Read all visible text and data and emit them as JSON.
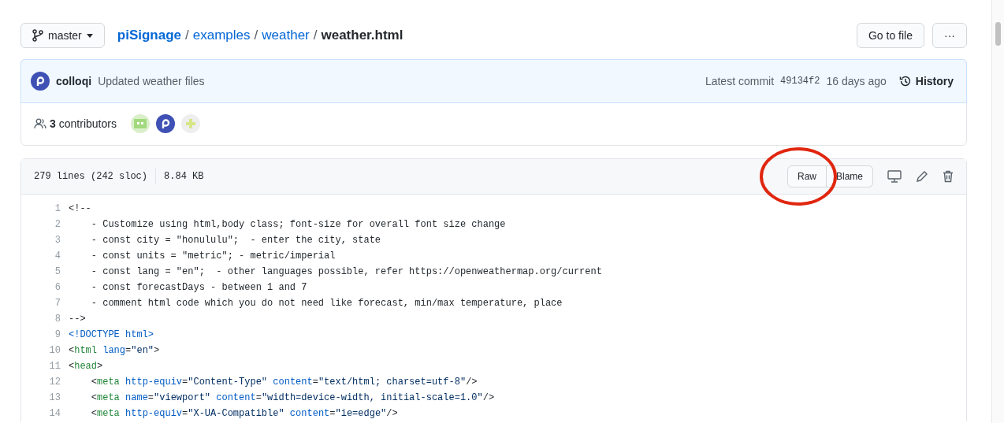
{
  "branch": {
    "label": "master"
  },
  "breadcrumb_separator": "/",
  "breadcrumb": [
    {
      "text": "piSignage",
      "kind": "repo"
    },
    {
      "text": "examples",
      "kind": "link"
    },
    {
      "text": "weather",
      "kind": "link"
    },
    {
      "text": "weather.html",
      "kind": "current"
    }
  ],
  "actions": {
    "go_to_file": "Go to file",
    "more": "···"
  },
  "commit": {
    "author": "colloqi",
    "message": "Updated weather files",
    "latest_label": "Latest commit",
    "sha": "49134f2",
    "age": "16 days ago",
    "history": "History"
  },
  "contributors": {
    "count": "3",
    "label": "contributors",
    "avatars": [
      {
        "kind": "green"
      },
      {
        "kind": "p"
      },
      {
        "kind": "cross"
      }
    ]
  },
  "file": {
    "lines": "279 lines (242 sloc)",
    "size": "8.84 KB",
    "raw": "Raw",
    "blame": "Blame"
  },
  "annotation": {
    "kind": "circle",
    "color": "#e0260f"
  },
  "code": [
    {
      "num": "1",
      "tokens": [
        {
          "text": "<!--",
          "kind": "plain"
        }
      ]
    },
    {
      "num": "2",
      "tokens": [
        {
          "text": "    - Customize using html,body class; font-size for overall font size change",
          "kind": "plain"
        }
      ]
    },
    {
      "num": "3",
      "tokens": [
        {
          "text": "    - const city = \"honululu\";  - enter the city, state",
          "kind": "plain"
        }
      ]
    },
    {
      "num": "4",
      "tokens": [
        {
          "text": "    - const units = \"metric\"; - metric/imperial",
          "kind": "plain"
        }
      ]
    },
    {
      "num": "5",
      "tokens": [
        {
          "text": "    - const lang = \"en\";  - other languages possible, refer https://openweathermap.org/current",
          "kind": "plain"
        }
      ]
    },
    {
      "num": "6",
      "tokens": [
        {
          "text": "    - const forecastDays - between 1 and 7",
          "kind": "plain"
        }
      ]
    },
    {
      "num": "7",
      "tokens": [
        {
          "text": "    - comment html code which you do not need like forecast, min/max temperature, place",
          "kind": "plain"
        }
      ]
    },
    {
      "num": "8",
      "tokens": [
        {
          "text": "-->",
          "kind": "plain"
        }
      ]
    },
    {
      "num": "9",
      "tokens": [
        {
          "text": "<!DOCTYPE html>",
          "kind": "attr"
        }
      ]
    },
    {
      "num": "10",
      "tokens": [
        {
          "text": "<",
          "kind": "plain"
        },
        {
          "text": "html",
          "kind": "tag"
        },
        {
          "text": " lang",
          "kind": "attr"
        },
        {
          "text": "=",
          "kind": "plain"
        },
        {
          "text": "\"en\"",
          "kind": "string"
        },
        {
          "text": ">",
          "kind": "plain"
        }
      ]
    },
    {
      "num": "11",
      "tokens": [
        {
          "text": "<",
          "kind": "plain"
        },
        {
          "text": "head",
          "kind": "tag"
        },
        {
          "text": ">",
          "kind": "plain"
        }
      ]
    },
    {
      "num": "12",
      "tokens": [
        {
          "text": "    <",
          "kind": "plain"
        },
        {
          "text": "meta",
          "kind": "tag"
        },
        {
          "text": " http-equiv",
          "kind": "attr"
        },
        {
          "text": "=",
          "kind": "plain"
        },
        {
          "text": "\"Content-Type\"",
          "kind": "string"
        },
        {
          "text": " content",
          "kind": "attr"
        },
        {
          "text": "=",
          "kind": "plain"
        },
        {
          "text": "\"text/html; charset=utf-8\"",
          "kind": "string"
        },
        {
          "text": "/>",
          "kind": "plain"
        }
      ]
    },
    {
      "num": "13",
      "tokens": [
        {
          "text": "    <",
          "kind": "plain"
        },
        {
          "text": "meta",
          "kind": "tag"
        },
        {
          "text": " name",
          "kind": "attr"
        },
        {
          "text": "=",
          "kind": "plain"
        },
        {
          "text": "\"viewport\"",
          "kind": "string"
        },
        {
          "text": " content",
          "kind": "attr"
        },
        {
          "text": "=",
          "kind": "plain"
        },
        {
          "text": "\"width=device-width, initial-scale=1.0\"",
          "kind": "string"
        },
        {
          "text": "/>",
          "kind": "plain"
        }
      ]
    },
    {
      "num": "14",
      "tokens": [
        {
          "text": "    <",
          "kind": "plain"
        },
        {
          "text": "meta",
          "kind": "tag"
        },
        {
          "text": " http-equiv",
          "kind": "attr"
        },
        {
          "text": "=",
          "kind": "plain"
        },
        {
          "text": "\"X-UA-Compatible\"",
          "kind": "string"
        },
        {
          "text": " content",
          "kind": "attr"
        },
        {
          "text": "=",
          "kind": "plain"
        },
        {
          "text": "\"ie=edge\"",
          "kind": "string"
        },
        {
          "text": "/>",
          "kind": "plain"
        }
      ]
    }
  ]
}
